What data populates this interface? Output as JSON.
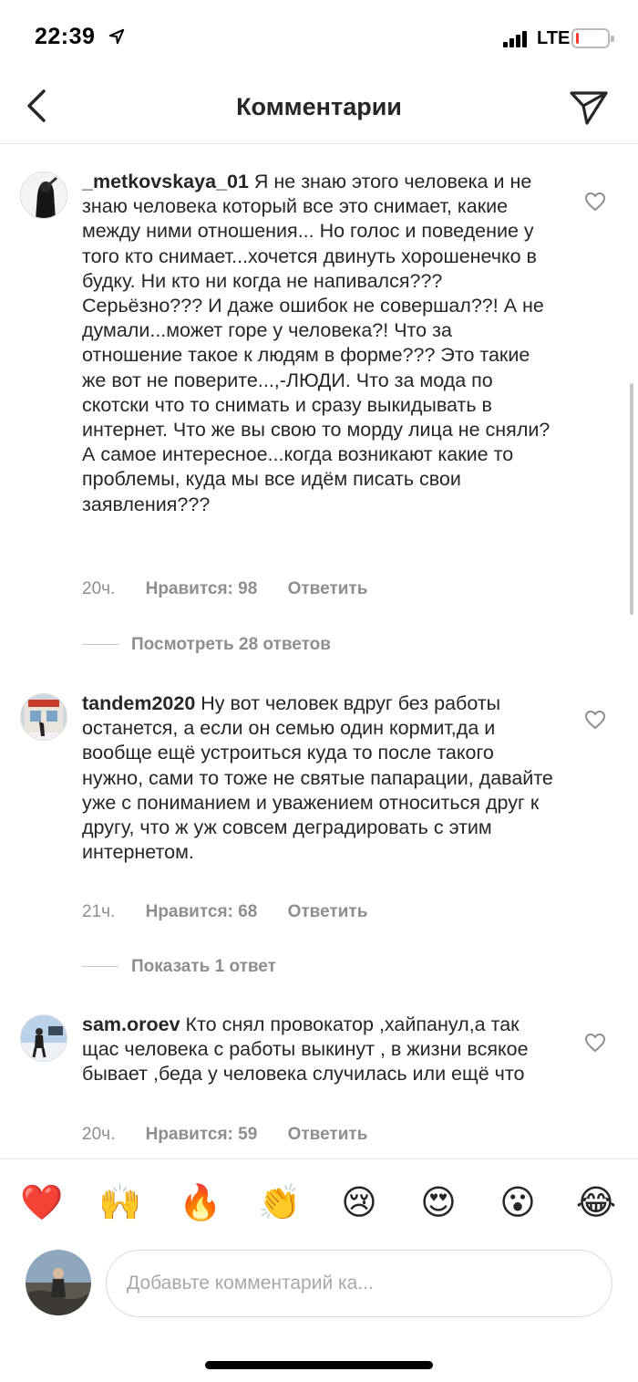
{
  "status": {
    "time": "22:39",
    "network": "LTE",
    "battery_level": 0.1
  },
  "header": {
    "title": "Комментарии"
  },
  "comments": [
    {
      "username": "_metkovskaya_01",
      "text": "Я не знаю этого человека и не знаю человека который все это снимает, какие между ними отношения... Но голос и поведение у того кто снимает...хочется двинуть хорошенечко в будку. Ни кто ни когда не напивался??? Серьёзно??? И даже ошибок не совершал??! А не думали...может горе у человека?! Что за отношение такое к людям в форме??? Это такие же вот не поверите...,-ЛЮДИ. Что за мода по скотски что то снимать и сразу выкидывать в интернет.  Что же вы свою то морду лица не сняли? А самое интересное...когда возникают какие то проблемы, куда мы все идём писать свои заявления???",
      "time": "20ч.",
      "likes": "Нравится: 98",
      "reply": "Ответить",
      "replies_toggle": "Посмотреть 28 ответов"
    },
    {
      "username": "tandem2020",
      "text": "Ну вот человек вдруг без работы останется, а если он семью один кормит,да и вообще ещё устроиться куда то после такого нужно, сами то тоже не святые папарации, давайте уже с пониманием и уважением относиться друг к другу, что ж уж совсем деградировать с этим интернетом.",
      "time": "21ч.",
      "likes": "Нравится: 68",
      "reply": "Ответить",
      "replies_toggle": "Показать 1 ответ"
    },
    {
      "username": "sam.oroev",
      "text": "Кто снял провокатор ,хайпанул,а так щас человека с работы выкинут , в жизни всякое бывает ,беда у человека случилась или ещё что",
      "time": "20ч.",
      "likes": "Нравится: 59",
      "reply": "Ответить"
    }
  ],
  "emoji_bar": [
    "❤️",
    "🙌",
    "🔥",
    "👏",
    "😢",
    "😍",
    "😮",
    "😂"
  ],
  "composer": {
    "placeholder": "Добавьте комментарий ка..."
  }
}
